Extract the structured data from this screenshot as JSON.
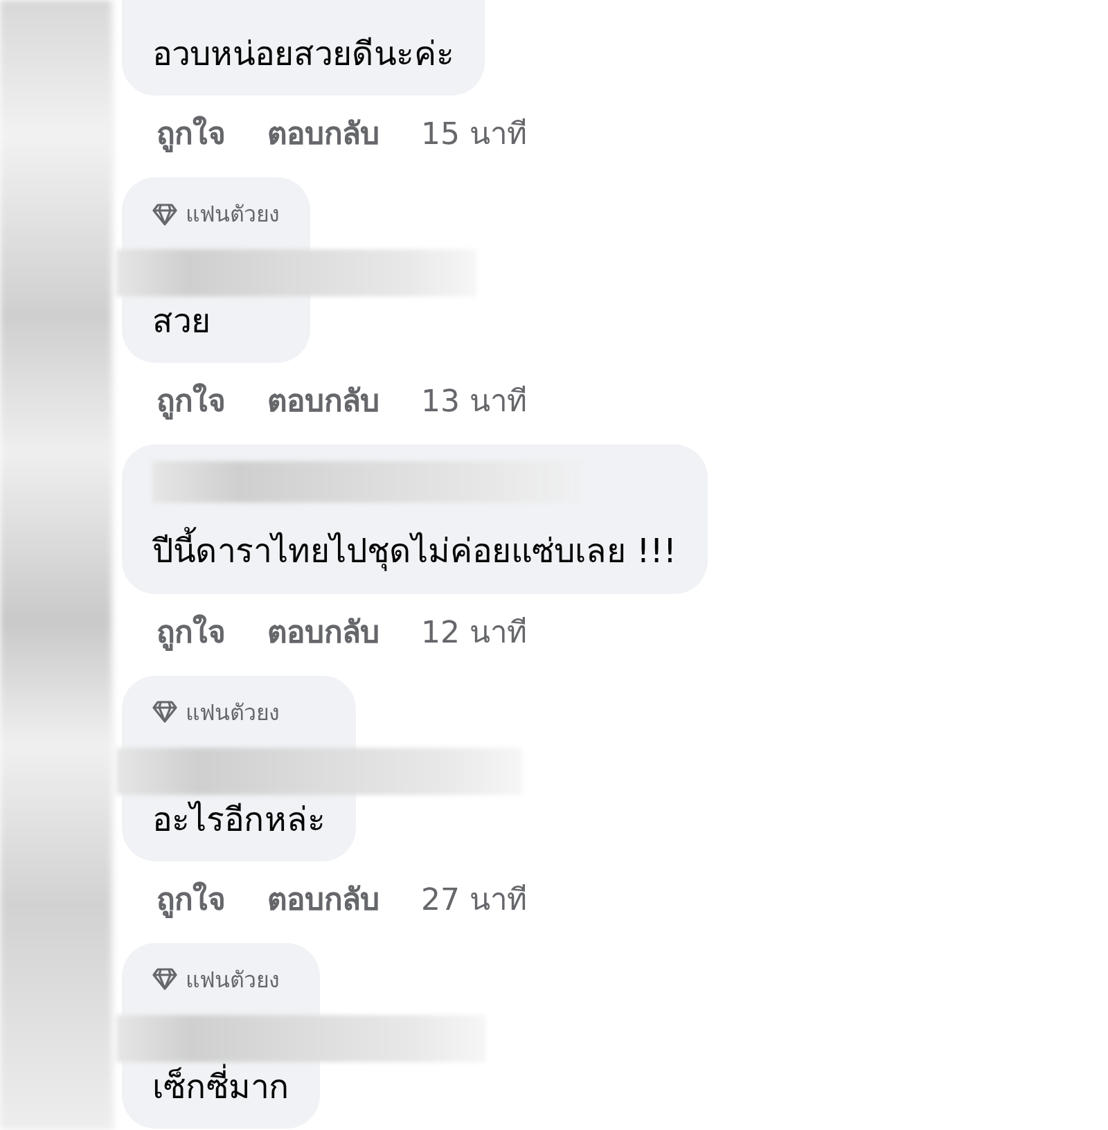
{
  "comments": [
    {
      "text": "อวบหน่อยสวยดีนะค่ะ",
      "actions": {
        "like": "ถูกใจ",
        "reply": "ตอบกลับ",
        "time": "15 นาที"
      }
    },
    {
      "badge": "แฟนตัวยง",
      "text": "สวย",
      "name_hidden": true,
      "actions": {
        "like": "ถูกใจ",
        "reply": "ตอบกลับ",
        "time": "13 นาที"
      }
    },
    {
      "text": "ปีนี้ดาราไทยไปชุดไม่ค่อยแซ่บเลย !!!",
      "name_hidden": true,
      "actions": {
        "like": "ถูกใจ",
        "reply": "ตอบกลับ",
        "time": "12 นาที"
      }
    },
    {
      "badge": "แฟนตัวยง",
      "text": "อะไรอีกหล่ะ",
      "name_hidden": true,
      "actions": {
        "like": "ถูกใจ",
        "reply": "ตอบกลับ",
        "time": "27 นาที"
      }
    },
    {
      "badge": "แฟนตัวยง",
      "text": "เซ็กซี่มาก",
      "name_hidden": true
    }
  ]
}
